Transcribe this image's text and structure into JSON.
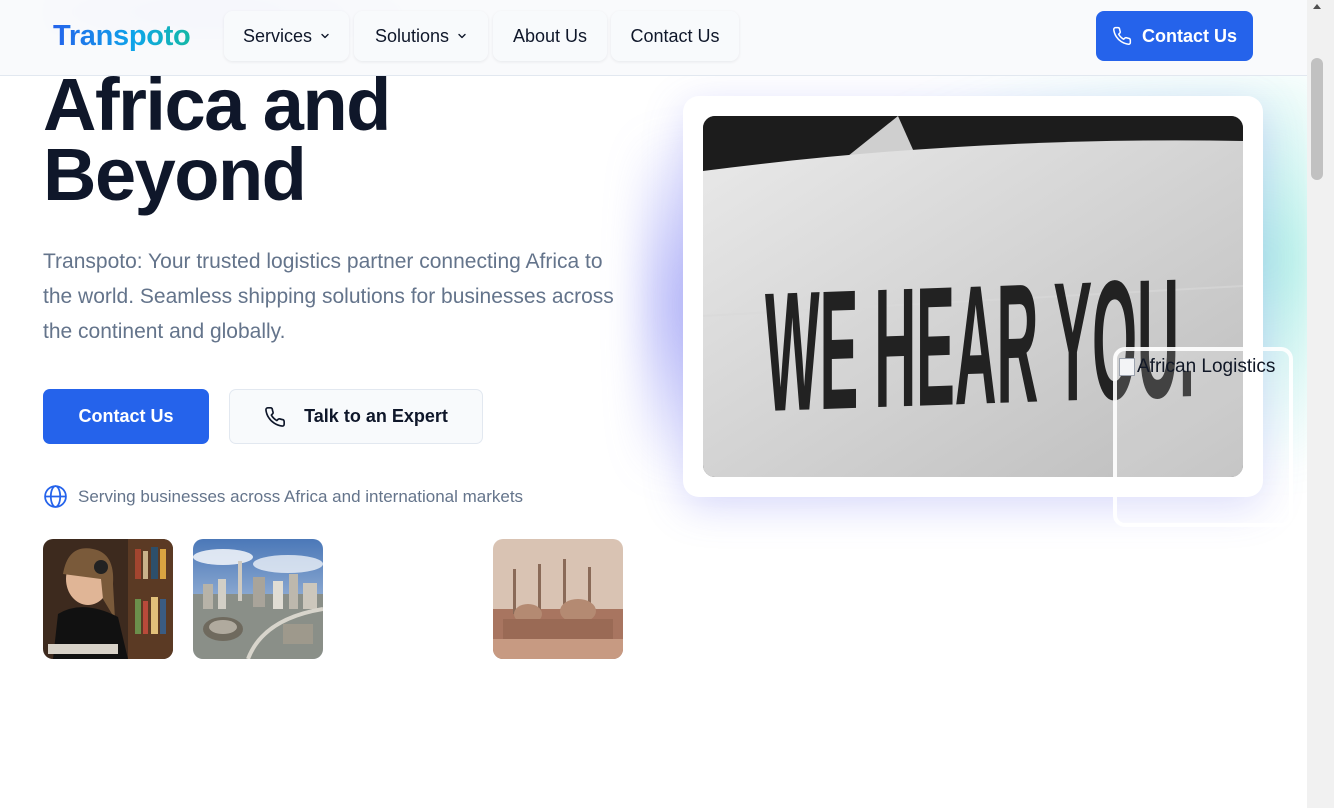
{
  "nav": {
    "logo": "Transpoto",
    "items": [
      {
        "label": "Services",
        "has_dropdown": true
      },
      {
        "label": "Solutions",
        "has_dropdown": true
      },
      {
        "label": "About Us",
        "has_dropdown": false
      },
      {
        "label": "Contact Us",
        "has_dropdown": false
      }
    ],
    "cta_label": "Contact Us",
    "cta_icon": "phone-icon"
  },
  "hero": {
    "title": "Africa and Beyond",
    "description": "Transpoto: Your trusted logistics partner connecting Africa to the world. Seamless shipping solutions for businesses across the continent and globally.",
    "primary_button": "Contact Us",
    "secondary_button": "Talk to an Expert",
    "secondary_icon": "phone-icon",
    "serving_text": "Serving businesses across Africa and international markets",
    "serving_icon": "globe-icon"
  },
  "media": {
    "main_image_text": "WE HEAR YOU.",
    "overlay_alt": "African Logistics"
  },
  "colors": {
    "primary": "#2563eb",
    "heading": "#0f172a",
    "muted": "#64748b",
    "accent_teal": "#14b8a6"
  }
}
